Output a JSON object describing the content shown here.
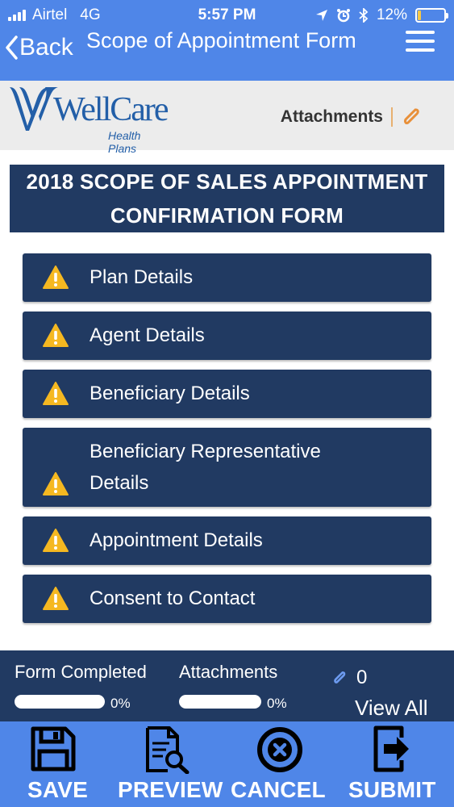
{
  "status_bar": {
    "carrier": "Airtel",
    "network": "4G",
    "time": "5:57 PM",
    "battery": "12%",
    "battery_level": 0.12
  },
  "nav": {
    "back_label": "Back",
    "title": "Scope of Appointment Form",
    "menu_icon": "hamburger-menu-icon"
  },
  "brand": {
    "logo_name": "WellCare",
    "logo_sub": "Health Plans",
    "attachments_label": "Attachments"
  },
  "form": {
    "title_line1": "2018 SCOPE OF SALES APPOINTMENT",
    "title_line2": "CONFIRMATION FORM"
  },
  "sections": [
    {
      "label": "Plan Details",
      "icon": "warning-icon"
    },
    {
      "label": "Agent Details",
      "icon": "warning-icon"
    },
    {
      "label": "Beneficiary Details",
      "icon": "warning-icon"
    },
    {
      "label_line1": "Beneficiary Representative",
      "label_line2": "Details",
      "icon": "warning-icon"
    },
    {
      "label": "Appointment Details",
      "icon": "warning-icon"
    },
    {
      "label": "Consent to Contact",
      "icon": "warning-icon"
    }
  ],
  "progress": {
    "form_completed_label": "Form Completed",
    "form_completed_pct": "0%",
    "form_completed_value": 0,
    "attachments_label": "Attachments",
    "attachments_pct": "0%",
    "attachments_value": 0,
    "attachment_count": "0",
    "view_all_label": "View All"
  },
  "toolbar": {
    "save_label": "SAVE",
    "preview_label": "PREVIEW",
    "cancel_label": "CANCEL",
    "submit_label": "SUBMIT"
  },
  "colors": {
    "header_blue": "#4f86e8",
    "navy": "#213a62",
    "warning_yellow": "#f5b821",
    "attachment_orange": "#e8903a",
    "logo_blue": "#235fa8"
  }
}
